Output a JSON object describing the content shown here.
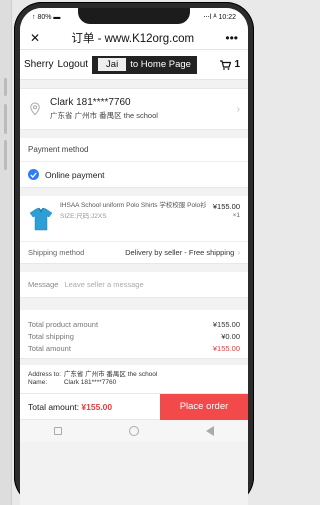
{
  "status": {
    "left": "↑ 80% ▬",
    "right": "⋅⋅⋅l ᴬ 10:22"
  },
  "titlebar": {
    "close": "✕",
    "title": "订单 - www.K12org.com",
    "more": "•••"
  },
  "topnav": {
    "user_label": "Sherry",
    "logout_label": "Logout",
    "account_name": "Jai",
    "home_link": "to Home Page",
    "cart_count": "1"
  },
  "address": {
    "name_phone": "Clark   181****7760",
    "full_address": "广东省 广州市 番禺区 the school"
  },
  "payment": {
    "heading": "Payment method",
    "option": "Online payment"
  },
  "product": {
    "title": "IHSAA School uniform Polo Shirts 学校校服 Polo衫",
    "sku": "SIZE:尺码:J2XS",
    "price": "¥155.00",
    "qty": "×1"
  },
  "shipping": {
    "label": "Shipping method",
    "value": "Delivery by seller - Free shipping"
  },
  "message": {
    "label": "Message",
    "placeholder": "Leave seller a message"
  },
  "totals": {
    "product_label": "Total product amount",
    "product_value": "¥155.00",
    "shipping_label": "Total shipping",
    "shipping_value": "¥0.00",
    "total_label": "Total amount",
    "total_value": "¥155.00"
  },
  "summary": {
    "address_label": "Address to:",
    "address_value": "广东省 广州市 番禺区 the school",
    "name_label": "Name:",
    "name_value": "Clark 181****7760"
  },
  "actionbar": {
    "amount_label": "Total amount:",
    "amount_value": "¥155.00",
    "place_order": "Place order"
  },
  "colors": {
    "accent_red": "#f2494a",
    "price_red": "#e63b3b",
    "check_blue": "#2f7df6"
  }
}
